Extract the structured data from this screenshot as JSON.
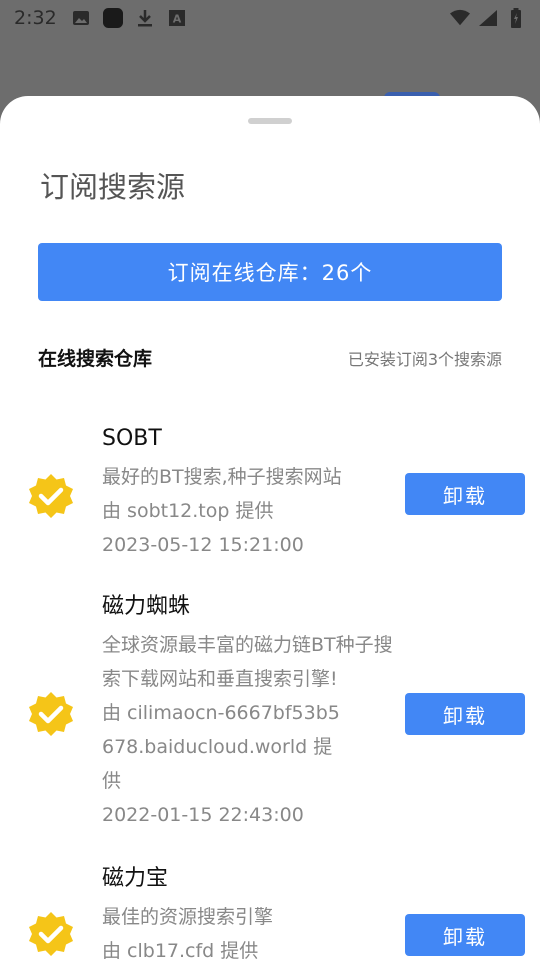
{
  "status_bar": {
    "time": "2:32",
    "icons_left": [
      "image-icon",
      "app-icon",
      "download-icon",
      "a-box-icon"
    ],
    "icons_right": [
      "wifi-icon",
      "signal-icon",
      "battery-icon"
    ]
  },
  "sheet": {
    "title": "订阅搜索源",
    "subscribe_button": "订阅在线仓库：26个",
    "section_title": "在线搜索仓库",
    "section_note": "已安装订阅3个搜索源"
  },
  "sources": [
    {
      "name": "SOBT",
      "description": "最好的BT搜索,种子搜索网站",
      "provider": "由 sobt12.top 提供",
      "date": "2023-05-12 15:21:00",
      "action": "卸载"
    },
    {
      "name": "磁力蜘蛛",
      "description": "全球资源最丰富的磁力链BT种子搜索下载网站和垂直搜索引擎!",
      "provider": "由 cilimaocn-6667bf53b5678.baiducloud.world 提供",
      "date": "2022-01-15 22:43:00",
      "action": "卸载"
    },
    {
      "name": "磁力宝",
      "description": "最佳的资源搜索引擎",
      "provider": "由 clb17.cfd 提供",
      "date": "",
      "action": "卸载"
    }
  ],
  "colors": {
    "accent": "#4287f5",
    "badge": "#f5c518",
    "scrim": "#6d6d6d"
  }
}
